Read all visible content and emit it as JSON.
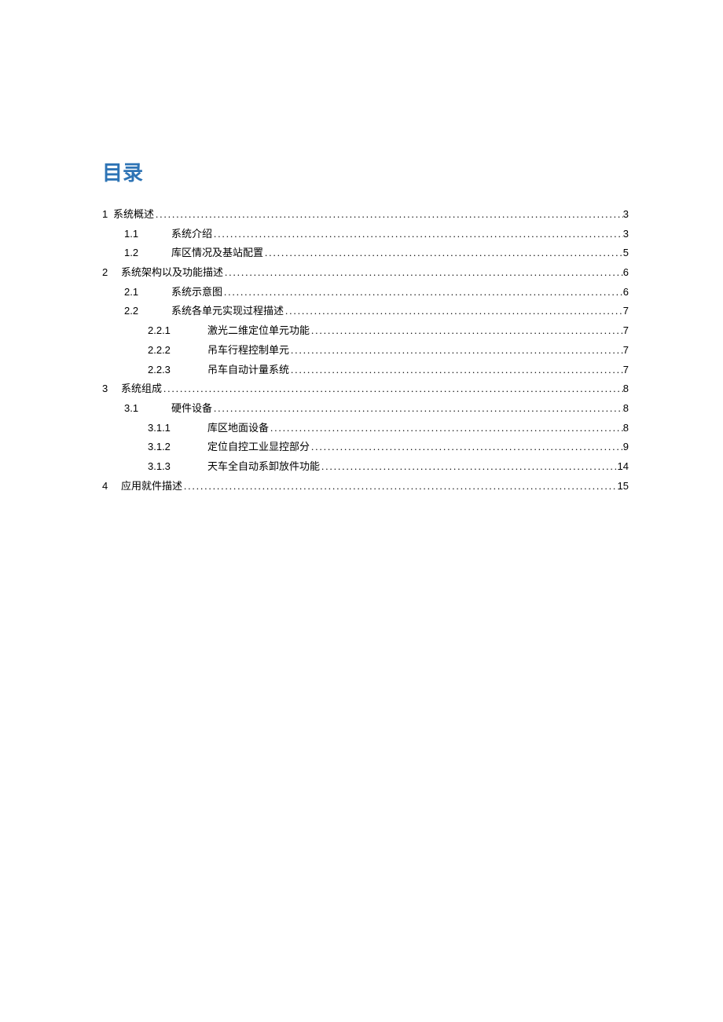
{
  "title": "目录",
  "entries": [
    {
      "level": 1,
      "num": "1",
      "label": " 系统概述",
      "page": "3",
      "compact": true
    },
    {
      "level": 2,
      "num": "1.1",
      "label": "系统介绍",
      "page": "3"
    },
    {
      "level": 2,
      "num": "1.2",
      "label": "库区情况及基站配置",
      "page": "5"
    },
    {
      "level": 1,
      "num": "2",
      "label": "系统架构以及功能描述",
      "page": "6"
    },
    {
      "level": 2,
      "num": "2.1",
      "label": "系统示意图",
      "page": "6"
    },
    {
      "level": 2,
      "num": "2.2",
      "label": "系统各单元实现过程描述",
      "page": "7"
    },
    {
      "level": 3,
      "num": "2.2.1",
      "label": "激光二维定位单元功能",
      "page": "7"
    },
    {
      "level": 3,
      "num": "2.2.2",
      "label": "吊车行程控制单元",
      "page": "7"
    },
    {
      "level": 3,
      "num": "2.2.3",
      "label": "吊车自动计量系统",
      "page": "7"
    },
    {
      "level": 1,
      "num": "3",
      "label": "系统组成",
      "page": "8"
    },
    {
      "level": 2,
      "num": "3.1",
      "label": "硬件设备",
      "page": "8"
    },
    {
      "level": 3,
      "num": "3.1.1",
      "label": "库区地面设备",
      "page": "8"
    },
    {
      "level": 3,
      "num": "3.1.2",
      "label": "定位自控工业显控部分",
      "page": "9"
    },
    {
      "level": 3,
      "num": "3.1.3",
      "label": "天车全自动系卸放件功能",
      "page": "14"
    },
    {
      "level": 1,
      "num": "4",
      "label": "应用就件描述",
      "page": "15"
    }
  ]
}
